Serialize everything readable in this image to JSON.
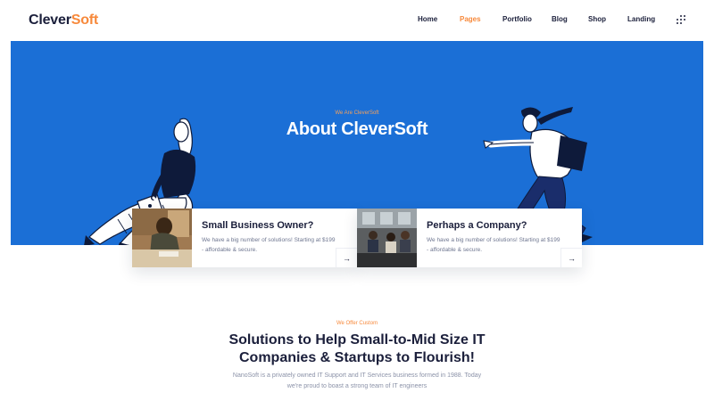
{
  "header": {
    "logo_part1": "Clever",
    "logo_part2": "Soft",
    "nav": [
      "Home",
      "Pages",
      "Portfolio",
      "Blog",
      "Shop",
      "Landing"
    ],
    "active_nav": "Pages",
    "menu_icon": "grid-dots-icon"
  },
  "hero": {
    "kicker": "We Are CleverSoft",
    "title": "About CleverSoft",
    "background_color": "#1b6fd6"
  },
  "cards": [
    {
      "title": "Small Business Owner?",
      "description": "We have a big number of solutions! Starting at $199 - affordable & secure.",
      "arrow_icon": "arrow-right-icon"
    },
    {
      "title": "Perhaps a Company?",
      "description": "We have a big number of solutions! Starting at $199 - affordable & secure.",
      "arrow_icon": "arrow-right-icon"
    }
  ],
  "section": {
    "kicker": "We Offer Custom",
    "title_line1": "Solutions to Help Small-to-Mid Size IT",
    "title_line2": "Companies & Startups to Flourish!",
    "desc_line1": "NanoSoft is a privately owned IT Support and IT Services business formed in 1988. Today",
    "desc_line2": "we're proud to boast a strong team of IT engineers"
  },
  "colors": {
    "accent": "#f7893b",
    "dark": "#1b1f3b",
    "hero_blue": "#1b6fd6"
  }
}
